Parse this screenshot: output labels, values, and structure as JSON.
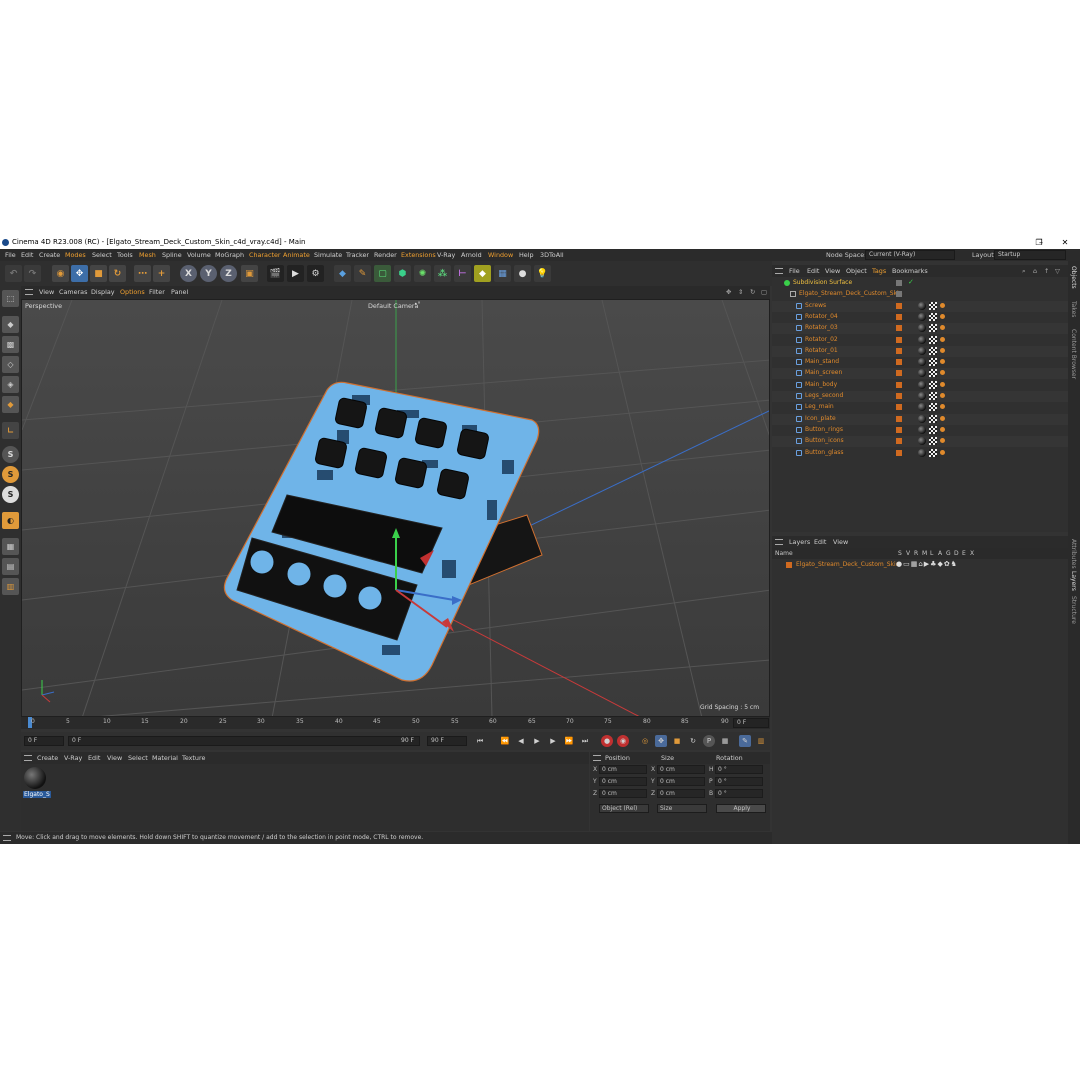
{
  "window": {
    "title": "Cinema 4D R23.008 (RC) - [Elgato_Stream_Deck_Custom_Skin_c4d_vray.c4d] - Main",
    "minimize": "–",
    "maximize": "❐",
    "close": "✕"
  },
  "menu": [
    "File",
    "Edit",
    "Create",
    "Modes",
    "Select",
    "Tools",
    "Mesh",
    "Spline",
    "Volume",
    "MoGraph",
    "Character",
    "Animate",
    "Simulate",
    "Tracker",
    "Render",
    "Extensions",
    "V-Ray",
    "Arnold",
    "Window",
    "Help",
    "3DToAll"
  ],
  "header_right": {
    "node_space_label": "Node Space:",
    "node_space_value": "Current (V-Ray)",
    "layout_label": "Layout:",
    "layout_value": "Startup"
  },
  "toolbar": {
    "axis_x": "X",
    "axis_y": "Y",
    "axis_z": "Z"
  },
  "viewport": {
    "menu": [
      "View",
      "Cameras",
      "Display",
      "Options",
      "Filter",
      "Panel"
    ],
    "label": "Perspective",
    "camera": "Default Camera",
    "camera_marker": "•°",
    "grid_spacing": "Grid Spacing : 5 cm"
  },
  "timeline": {
    "ticks": [
      "0",
      "5",
      "10",
      "15",
      "20",
      "25",
      "30",
      "35",
      "40",
      "45",
      "50",
      "55",
      "60",
      "65",
      "70",
      "75",
      "80",
      "85",
      "90"
    ],
    "current_frame": "0 F",
    "start": "0 F",
    "range_start": "0 F",
    "range_end": "90 F",
    "end": "90 F"
  },
  "material_manager": {
    "menu": [
      "Create",
      "V-Ray",
      "Edit",
      "View",
      "Select",
      "Material",
      "Texture"
    ],
    "material_name": "Elgato_S"
  },
  "attributes": {
    "headers": [
      "Position",
      "Size",
      "Rotation"
    ],
    "rows": [
      {
        "axis": "X",
        "pos": "0 cm",
        "saxis": "X",
        "size": "0 cm",
        "raxis": "H",
        "rot": "0 °"
      },
      {
        "axis": "Y",
        "pos": "0 cm",
        "saxis": "Y",
        "size": "0 cm",
        "raxis": "P",
        "rot": "0 °"
      },
      {
        "axis": "Z",
        "pos": "0 cm",
        "saxis": "Z",
        "size": "0 cm",
        "raxis": "B",
        "rot": "0 °"
      }
    ],
    "coord_mode": "Object (Rel)",
    "size_mode": "Size",
    "apply": "Apply"
  },
  "status": "Move: Click and drag to move elements. Hold down SHIFT to quantize movement / add to the selection in point mode, CTRL to remove.",
  "object_manager": {
    "menu": [
      "File",
      "Edit",
      "View",
      "Object",
      "Tags",
      "Bookmarks"
    ],
    "objects": [
      "Subdivision Surface",
      "Elgato_Stream_Deck_Custom_Skin",
      "Screws",
      "Rotator_04",
      "Rotator_03",
      "Rotator_02",
      "Rotator_01",
      "Main_stand",
      "Main_screen",
      "Main_body",
      "Legs_second",
      "Leg_main",
      "Icon_plate",
      "Button_rings",
      "Button_icons",
      "Button_glass"
    ]
  },
  "layers": {
    "menu": [
      "Layers",
      "Edit",
      "View"
    ],
    "name_header": "Name",
    "columns": [
      "S",
      "V",
      "R",
      "M",
      "L",
      "A",
      "G",
      "D",
      "E",
      "X"
    ],
    "layer_name": "Elgato_Stream_Deck_Custom_Skin"
  },
  "side_tabs": [
    "Objects",
    "Takes",
    "Content Browser",
    "Attributes",
    "Layers",
    "Structure"
  ],
  "colors": {
    "accent": "#f0a030",
    "object_text": "#e08a2c",
    "skin_blue": "#6fb4e8"
  }
}
